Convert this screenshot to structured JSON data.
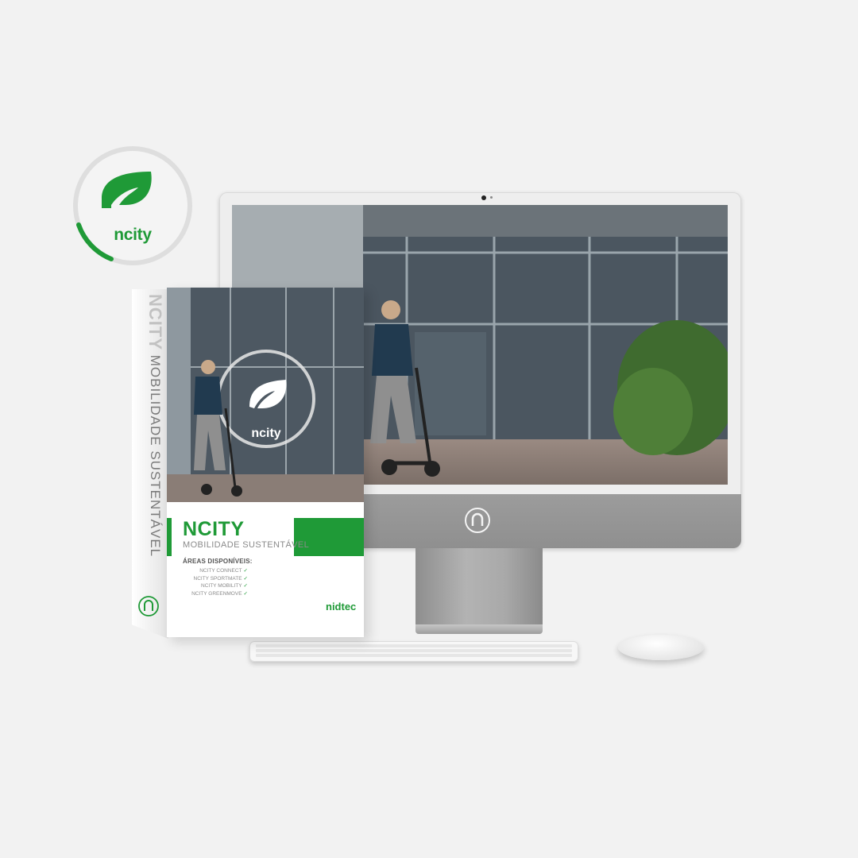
{
  "badge": {
    "brand": "ncity"
  },
  "box": {
    "spine_title": "NCITY",
    "spine_subtitle": "MOBILIDADE SUSTENTÁVEL",
    "title": "NCITY",
    "subtitle": "MOBILIDADE SUSTENTÁVEL",
    "cover_brand": "ncity",
    "areas_label": "ÁREAS DISPONÍVEIS:",
    "areas": [
      "NCITY CONNECT",
      "NCITY SPORTMATE",
      "NCITY MOBILITY",
      "NCITY GREENMOVE"
    ],
    "brand": "nidtec"
  },
  "colors": {
    "accent": "#1f9a37",
    "background": "#f2f2f2",
    "chin": "#999999"
  },
  "icons": [
    "leaf-icon",
    "n-logo-icon",
    "check-icon"
  ]
}
